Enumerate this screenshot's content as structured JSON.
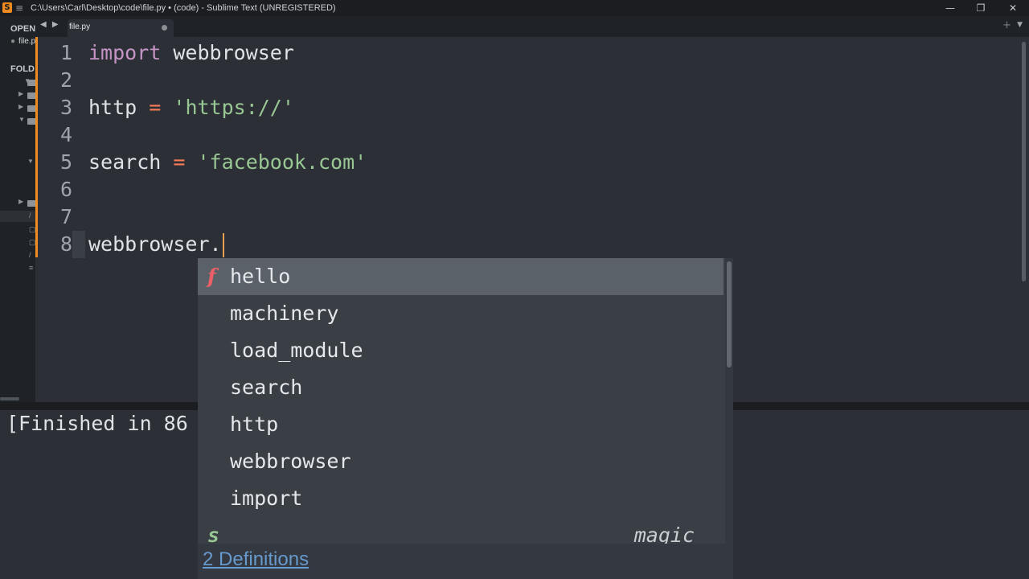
{
  "window": {
    "title": "C:\\Users\\Carl\\Desktop\\code\\file.py • (code) - Sublime Text (UNREGISTERED)",
    "logo_glyph": "S",
    "menu_glyph": "≡",
    "minimize_glyph": "—",
    "restore_glyph": "❐",
    "close_glyph": "✕"
  },
  "sidebar": {
    "open_header": "OPEN",
    "open_file": "file.py",
    "folders_header": "FOLD",
    "file_glyph": "/"
  },
  "tabs": [
    {
      "label": "file.py",
      "modified": true
    }
  ],
  "tabbar": {
    "nav_arrows": "◀ ▶",
    "plus": "+",
    "chevron": "▼"
  },
  "editor": {
    "lines": [
      {
        "number": "1",
        "tokens": [
          {
            "t": "kw",
            "v": "import"
          },
          {
            "t": "pl",
            "v": " webbrowser"
          }
        ]
      },
      {
        "number": "2",
        "tokens": []
      },
      {
        "number": "3",
        "tokens": [
          {
            "t": "pl",
            "v": "http "
          },
          {
            "t": "op",
            "v": "="
          },
          {
            "t": "pl",
            "v": " "
          },
          {
            "t": "str",
            "v": "'https://'"
          }
        ]
      },
      {
        "number": "4",
        "tokens": []
      },
      {
        "number": "5",
        "tokens": [
          {
            "t": "pl",
            "v": "search "
          },
          {
            "t": "op",
            "v": "="
          },
          {
            "t": "pl",
            "v": " "
          },
          {
            "t": "str",
            "v": "'facebook.com'"
          }
        ]
      },
      {
        "number": "6",
        "tokens": []
      },
      {
        "number": "7",
        "tokens": []
      },
      {
        "number": "8",
        "tokens": [
          {
            "t": "pl",
            "v": "webbrowser."
          }
        ]
      }
    ],
    "current_line": 8
  },
  "console": {
    "output": "[Finished in 86"
  },
  "autocomplete": {
    "items": [
      {
        "kind": "f",
        "name": "hello",
        "selected": true
      },
      {
        "kind": "",
        "name": "machinery"
      },
      {
        "kind": "",
        "name": "load_module"
      },
      {
        "kind": "",
        "name": "search"
      },
      {
        "kind": "",
        "name": "http"
      },
      {
        "kind": "",
        "name": "webbrowser"
      },
      {
        "kind": "",
        "name": "import"
      },
      {
        "kind": "s",
        "name": "",
        "hint": "magic"
      }
    ],
    "definitions_link": "2 Definitions"
  },
  "colors": {
    "accent": "#ef8a1f",
    "keyword": "#c594c5",
    "operator": "#f97b58",
    "string": "#99c794",
    "link": "#6699cc",
    "function_kind": "#ec5f67"
  }
}
